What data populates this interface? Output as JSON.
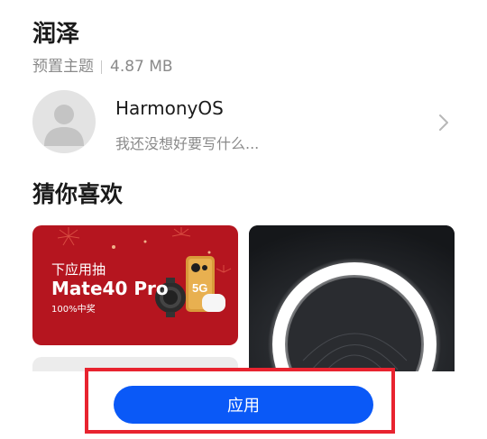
{
  "theme": {
    "name": "润泽",
    "category": "预置主题",
    "size": "4.87 MB"
  },
  "author": {
    "name": "HarmonyOS",
    "signature": "我还没想好要写什么..."
  },
  "recommend": {
    "title": "猜你喜欢",
    "ad": {
      "line1": "下应用抽",
      "line2": "Mate40 Pro",
      "line3": "100%中奖",
      "badge": "5G"
    }
  },
  "actions": {
    "apply_label": "应用"
  },
  "colors": {
    "accent": "#0a59f7",
    "highlight": "#e8232f",
    "ad_background": "#b5151f"
  }
}
